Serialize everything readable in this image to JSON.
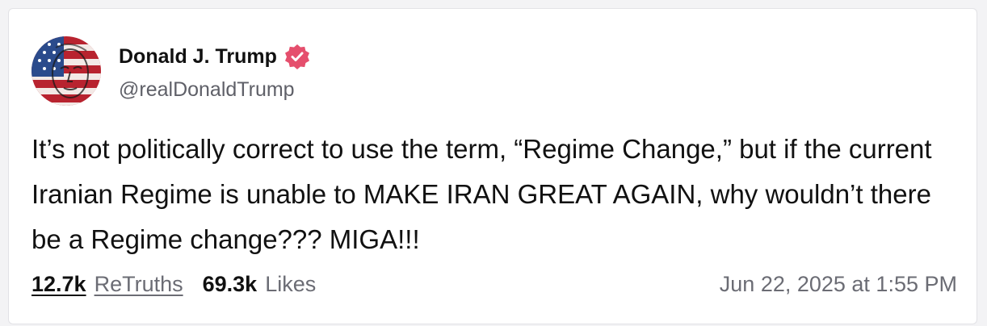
{
  "post": {
    "author": {
      "display_name": "Donald J. Trump",
      "handle": "@realDonaldTrump",
      "verified_icon": "verified-badge-icon",
      "verified_color": "#e54f6d"
    },
    "text": "It’s not politically correct to use the term, “Regime Change,” but if the current Iranian Regime is unable to MAKE IRAN GREAT AGAIN, why wouldn’t there be a Regime change??? MIGA!!!",
    "stats": {
      "retruths_count": "12.7k",
      "retruths_label": "ReTruths",
      "likes_count": "69.3k",
      "likes_label": "Likes"
    },
    "timestamp": "Jun 22, 2025 at 1:55 PM"
  }
}
